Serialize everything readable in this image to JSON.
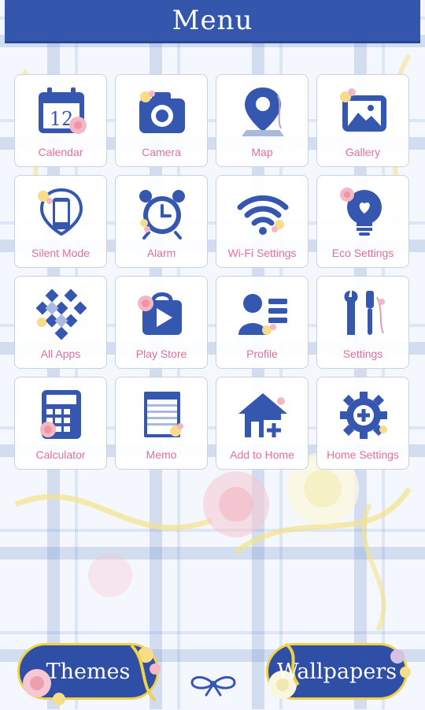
{
  "header": {
    "title": "Menu"
  },
  "calendar_day": "12",
  "tiles": [
    {
      "label": "Calendar",
      "icon": "calendar-icon"
    },
    {
      "label": "Camera",
      "icon": "camera-icon"
    },
    {
      "label": "Map",
      "icon": "map-pin-icon"
    },
    {
      "label": "Gallery",
      "icon": "gallery-icon"
    },
    {
      "label": "Silent Mode",
      "icon": "silent-mode-icon"
    },
    {
      "label": "Alarm",
      "icon": "alarm-clock-icon"
    },
    {
      "label": "Wi-Fi Settings",
      "icon": "wifi-icon"
    },
    {
      "label": "Eco Settings",
      "icon": "eco-bulb-icon"
    },
    {
      "label": "All Apps",
      "icon": "all-apps-icon"
    },
    {
      "label": "Play Store",
      "icon": "play-store-icon"
    },
    {
      "label": "Profile",
      "icon": "profile-icon"
    },
    {
      "label": "Settings",
      "icon": "tools-icon"
    },
    {
      "label": "Calculator",
      "icon": "calculator-icon"
    },
    {
      "label": "Memo",
      "icon": "memo-icon"
    },
    {
      "label": "Add to Home",
      "icon": "add-to-home-icon"
    },
    {
      "label": "Home Settings",
      "icon": "home-settings-gear-icon"
    }
  ],
  "buttons": {
    "themes": "Themes",
    "wallpapers": "Wallpapers"
  },
  "colors": {
    "header": "#3556ad",
    "icon": "#3557b0",
    "label": "#e0709a",
    "ribbon": "#f0d24a"
  }
}
